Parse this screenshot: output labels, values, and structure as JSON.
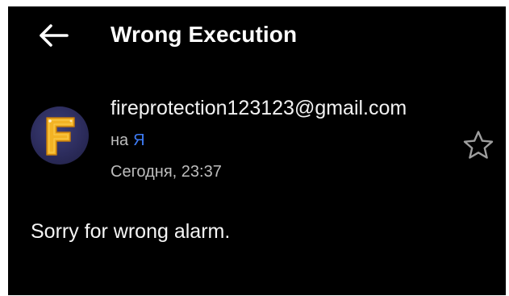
{
  "header": {
    "back_icon": "arrow-left-icon",
    "title": "Wrong Execution"
  },
  "message": {
    "sender": {
      "avatar_letter": "F",
      "avatar_colors": {
        "background": "#2c2c5c",
        "letter": "#f2b324"
      },
      "email": "fireprotection123123@gmail.com"
    },
    "recipient": {
      "prefix": "на",
      "name": "Я"
    },
    "date": "Сегодня, 23:37",
    "star_icon": "star-outline-icon",
    "body": "Sorry for wrong alarm."
  },
  "colors": {
    "background": "#000000",
    "text_primary": "#ffffff",
    "text_secondary": "#bdbdbd",
    "accent_link": "#3d7bf5"
  }
}
